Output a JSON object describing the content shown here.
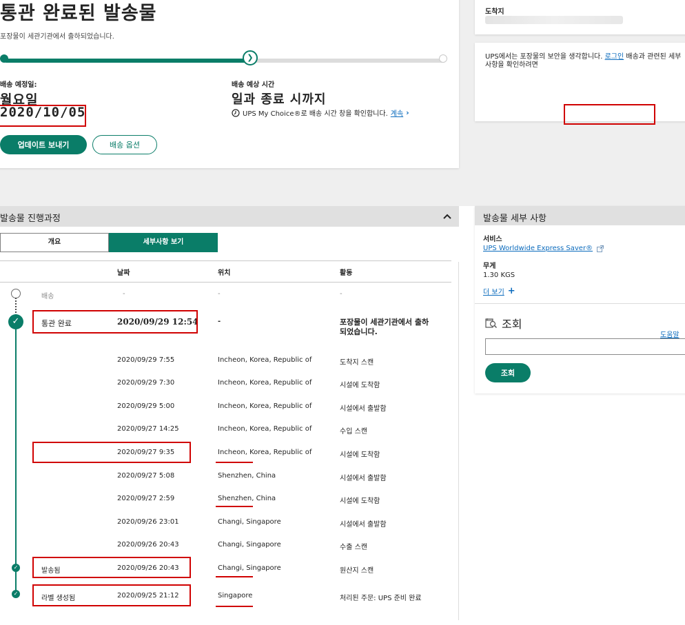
{
  "status": {
    "title": "통관 완료된 발송물",
    "subtitle": "포장물이 세관기관에서 출하되었습니다.",
    "progress_percent": 57,
    "progress_marker_icon": "chevron-right-icon",
    "scheduled_label": "배송 예정일:",
    "scheduled_day": "월요일",
    "scheduled_date": "2020/10/05",
    "window_label": "배송 예상 시간",
    "window_value": "일과 종료 시까지",
    "mychoice_text": "UPS My Choice®로 배송 시간 창을 확인합니다.",
    "mychoice_link": "계속",
    "update_button": "업데이트 보내기",
    "options_button": "배송 옵션"
  },
  "destination": {
    "label": "도착지"
  },
  "login_notice": {
    "text_before": "UPS에서는 포장물의 보안을 생각합니다.",
    "link": "로그인",
    "text_after": "배송과 관련된 세부 사항을 확인하려면"
  },
  "progress": {
    "title": "발송물 진행과정",
    "collapse_icon": "chevron-up-icon",
    "tabs": [
      "개요",
      "세부사항 보기"
    ],
    "active_tab": 1,
    "columns": [
      "날짜",
      "위치",
      "활동"
    ],
    "rows": [
      {
        "status": "배송",
        "date": "-",
        "location": "-",
        "activity": "-"
      },
      {
        "status": "통관 완료",
        "date": "2020/09/29  12:54",
        "location": "-",
        "activity": "포장물이 세관기관에서 출하\n되었습니다."
      },
      {
        "status": "",
        "date": "2020/09/29  7:55",
        "location": "Incheon, Korea, Republic of",
        "activity": "도착지 스캔"
      },
      {
        "status": "",
        "date": "2020/09/29  7:30",
        "location": "Incheon, Korea, Republic of",
        "activity": "시설에 도착함"
      },
      {
        "status": "",
        "date": "2020/09/29  5:00",
        "location": "Incheon, Korea, Republic of",
        "activity": "시설에서 출발함"
      },
      {
        "status": "",
        "date": "2020/09/27  14:25",
        "location": "Incheon, Korea, Republic of",
        "activity": "수입 스캔"
      },
      {
        "status": "",
        "date": "2020/09/27  9:35",
        "location": "Incheon, Korea, Republic of",
        "activity": "시설에 도착함"
      },
      {
        "status": "",
        "date": "2020/09/27  5:08",
        "location": "Shenzhen, China",
        "activity": "시설에서 출발함"
      },
      {
        "status": "",
        "date": "2020/09/27  2:59",
        "location": "Shenzhen, China",
        "activity": "시설에 도착함"
      },
      {
        "status": "",
        "date": "2020/09/26  23:01",
        "location": "Changi, Singapore",
        "activity": "시설에서 출발함"
      },
      {
        "status": "",
        "date": "2020/09/26  20:43",
        "location": "Changi, Singapore",
        "activity": "수출 스캔"
      },
      {
        "status": "발송됨",
        "date": "2020/09/26  20:43",
        "location": "Changi, Singapore",
        "activity": "원산지 스캔"
      },
      {
        "status": "라벨 생성됨",
        "date": "2020/09/25  21:12",
        "location": "Singapore",
        "activity": "처리된 주문: UPS 준비 완료"
      }
    ]
  },
  "details": {
    "title": "발송물 세부 사항",
    "service_label": "서비스",
    "service_value": "UPS Worldwide Express Saver®",
    "external_icon": "external-link-icon",
    "weight_label": "무게",
    "weight_value": "1.30 KGS",
    "more_link": "더 보기",
    "more_icon": "plus-icon",
    "lookup_title": "조회",
    "lookup_icon": "lookup-icon",
    "help_link": "도움말",
    "lookup_placeholder": "",
    "lookup_button": "조회"
  },
  "colors": {
    "brand_green": "#0a7d68",
    "link_blue": "#0b6bbd",
    "annotation_red": "#d00000"
  }
}
